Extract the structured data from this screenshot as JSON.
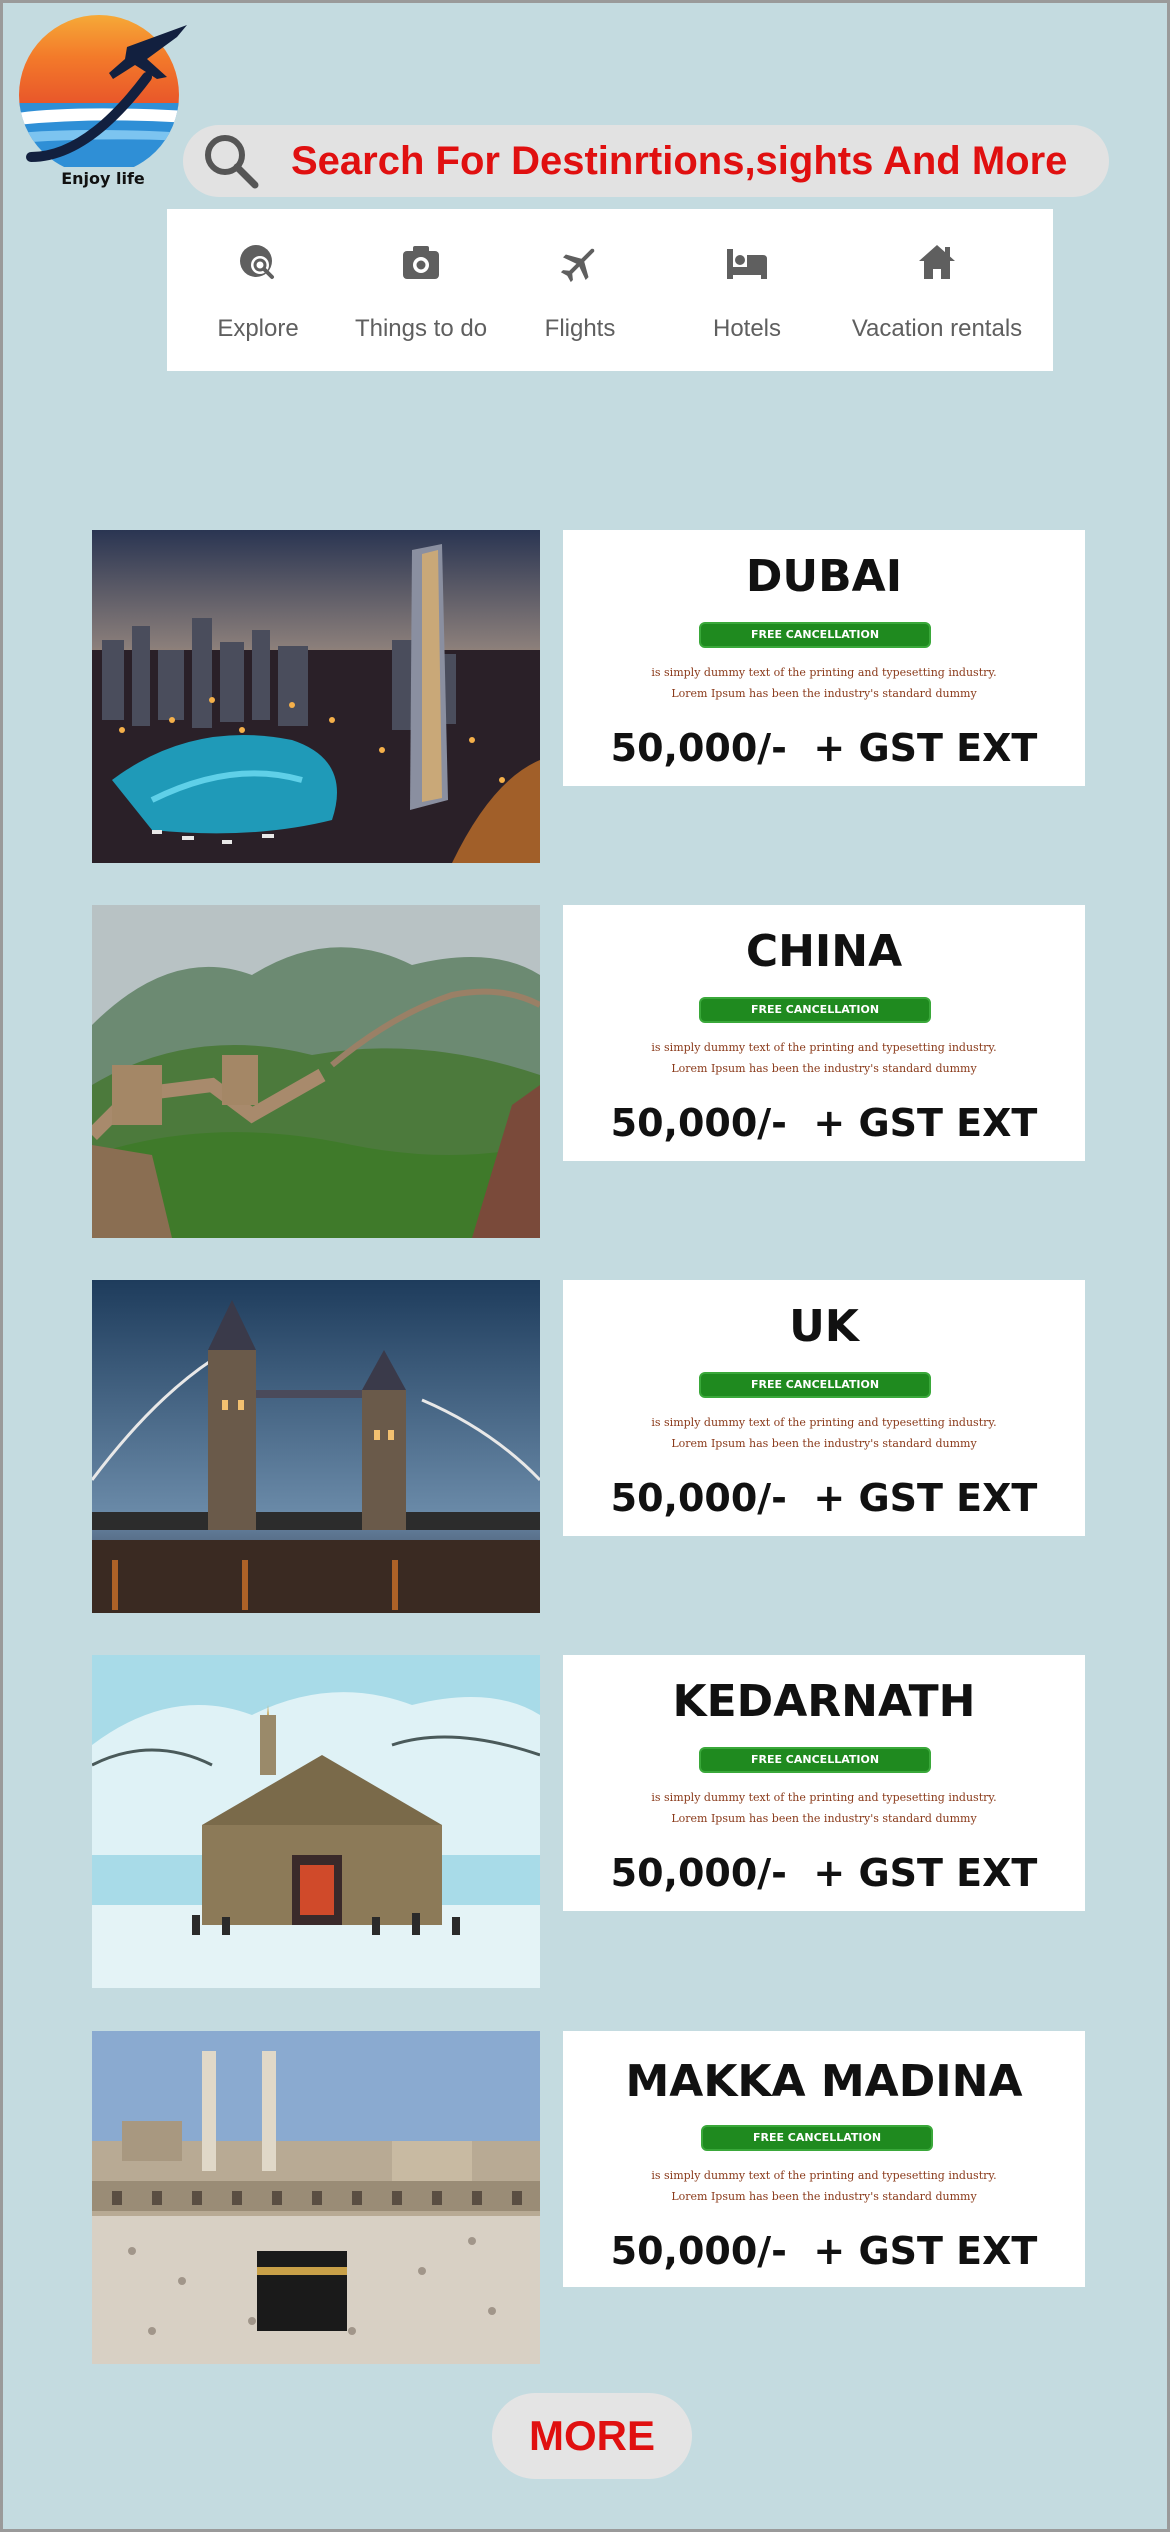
{
  "logo": {
    "text": "Enjoy life"
  },
  "search": {
    "text": "Search For Destinrtions,sights And More"
  },
  "categories": [
    {
      "label": "Explore",
      "icon": "explore-icon"
    },
    {
      "label": "Things to do",
      "icon": "camera-icon"
    },
    {
      "label": "Flights",
      "icon": "airplane-icon"
    },
    {
      "label": "Hotels",
      "icon": "bed-icon"
    },
    {
      "label": "Vacation rentals",
      "icon": "home-icon"
    }
  ],
  "cards": [
    {
      "name": "DUBAI",
      "badge": "FREE CANCELLATION",
      "desc1": "is simply dummy text of the printing and typesetting industry.",
      "desc2": "Lorem Ipsum has been the industry's standard dummy",
      "price": "50,000/-  + GST EXT"
    },
    {
      "name": "CHINA",
      "badge": "FREE CANCELLATION",
      "desc1": "is simply dummy text of the printing and typesetting industry.",
      "desc2": "Lorem Ipsum has been the industry's standard dummy",
      "price": "50,000/-  + GST EXT"
    },
    {
      "name": "UK",
      "badge": "FREE CANCELLATION",
      "desc1": "is simply dummy text of the printing and typesetting industry.",
      "desc2": "Lorem Ipsum has been the industry's standard dummy",
      "price": "50,000/-  + GST EXT"
    },
    {
      "name": "KEDARNATH",
      "badge": "FREE CANCELLATION",
      "desc1": "is simply dummy text of the printing and typesetting industry.",
      "desc2": "Lorem Ipsum has been the industry's standard dummy",
      "price": "50,000/-  + GST EXT"
    },
    {
      "name": "MAKKA MADINA",
      "badge": "FREE CANCELLATION",
      "desc1": "is simply dummy text of the printing and typesetting industry.",
      "desc2": "Lorem Ipsum has been the industry's standard dummy",
      "price": "50,000/-  + GST EXT"
    }
  ],
  "more": {
    "label": "MORE"
  },
  "colors": {
    "background": "#c4dbe0",
    "accent_red": "#e01010",
    "badge_green": "#1f8a1f"
  }
}
